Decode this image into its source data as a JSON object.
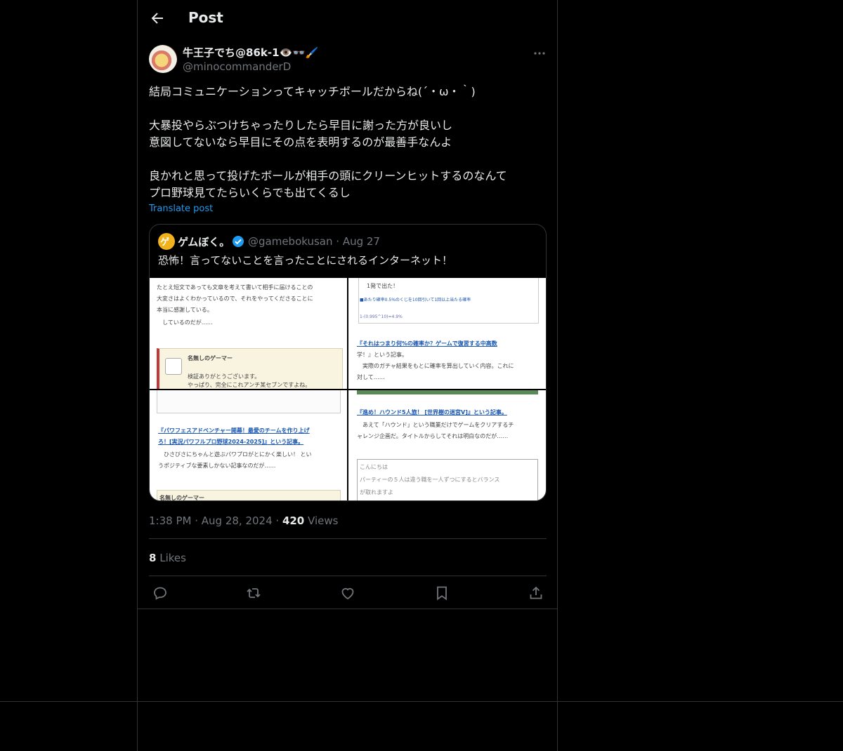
{
  "header": {
    "title": "Post"
  },
  "post": {
    "author_name": "牛王子でち@86k-1👁️👓🖌️",
    "author_handle": "@minocommanderD",
    "lines": [
      "結局コミュニケーションってキャッチボールだからね(´・ω・｀)",
      "",
      "大暴投やらぶつけちゃったりしたら早目に謝った方が良いし",
      "意図してないなら早目にその点を表明するのが最善手なんよ",
      "",
      "良かれと思って投げたボールが相手の頭にクリーンヒットするのなんて",
      "プロ野球見てたらいくらでも出てくるし"
    ],
    "translate": "Translate post",
    "time": "1:38 PM",
    "date": "Aug 28, 2024",
    "views_count": "420",
    "views_label": "Views",
    "likes_count": "8",
    "likes_label": "Likes"
  },
  "quote": {
    "avatar_text": "ゲ",
    "name": "ゲムぼく。",
    "handle": "@gamebokusan",
    "date": "Aug 27",
    "text": "恐怖！言ってないことを言ったことにされるインターネット！",
    "images": {
      "c1": [
        "たとえ短文であっても文章を考えて書いて相手に届けることの",
        "大変さはよくわかっているので、それをやってくださることに",
        "本当に感謝している。",
        "　しているのだが……",
        "名無しのゲーマー",
        "検証ありがとうございます。",
        "やっぱり、完全にこれアンチ某セブンですよね。"
      ],
      "c2": [
        "1発で出た！",
        "■あたり確率0.5%のくじを10回引いて1回以上当たる確率",
        "1-(0.995^10)=4.9%",
        "『それはつまり何%の確率か？ゲームで復習する中高数",
        "学！』という記事。",
        "　実際のガチャ結果をもとに確率を算出していく内容。これに",
        "対して……"
      ],
      "c3": [
        "『パワフェスアドベンチャー開幕！最愛のチームを作り上げ",
        "ろ！[実況パワフルプロ野球2024-2025]』という記事。",
        "　ひさびさにちゃんと遊ぶパワプロがとにかく楽しい！ とい",
        "うポジティブな要素しかない記事なのだが……",
        "名無しのゲーマー"
      ],
      "c4": [
        "『進め！ハウンド5人旅！ [世界樹の迷宮V]』という記事。",
        "　あえて「ハウンド」という職業だけでゲームをクリアするチ",
        "ャレンジ企画だ。タイトルからしてそれは明白なのだが……",
        "こんにちは",
        "パーティーの５人は違う職を一人ずつにするとバランス",
        "が取れますよ"
      ]
    }
  },
  "icons": [
    "back-arrow-icon",
    "more-icon",
    "verified-icon",
    "reply-icon",
    "repost-icon",
    "like-icon",
    "bookmark-icon",
    "share-icon"
  ],
  "colors": {
    "accent": "#1d9bf0",
    "text": "#e7e9ea",
    "muted": "#71767b",
    "border": "#2f3336",
    "background": "#000000"
  }
}
